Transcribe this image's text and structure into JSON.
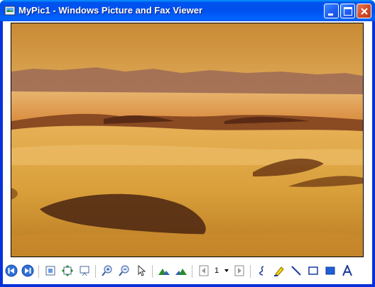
{
  "window": {
    "title": "MyPic1 - Windows Picture and Fax Viewer"
  },
  "colors": {
    "titlebar_blue": "#0053ee",
    "frame_blue": "#0831d9",
    "close_red": "#d44a24"
  },
  "image": {
    "subject": "desert-sand-dunes-icon"
  },
  "toolbar": {
    "page_number": "1",
    "icons": [
      "previous-image-icon",
      "next-image-icon",
      "best-fit-icon",
      "actual-size-icon",
      "slideshow-icon",
      "zoom-in-icon",
      "zoom-out-icon",
      "pointer-icon",
      "rotate-clockwise-icon",
      "rotate-counterclockwise-icon",
      "previous-page-icon",
      "page-dropdown-icon",
      "next-page-icon",
      "freehand-icon",
      "highlighter-icon",
      "line-icon",
      "rectangle-icon",
      "filled-rectangle-icon",
      "text-annotation-icon"
    ]
  }
}
